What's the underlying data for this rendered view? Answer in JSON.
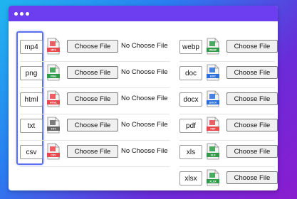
{
  "window": {
    "dots": 3
  },
  "choose_label": "Choose File",
  "status_text": "No Choose File",
  "left": [
    {
      "format": "mp4",
      "badge": "MP4",
      "color": "#e8474b"
    },
    {
      "format": "png",
      "badge": "PNG",
      "color": "#2f9a47"
    },
    {
      "format": "html",
      "badge": "HTML",
      "color": "#e8474b"
    },
    {
      "format": "txt",
      "badge": "TXT",
      "color": "#666666"
    },
    {
      "format": "csv",
      "badge": "CSV",
      "color": "#e8474b"
    }
  ],
  "right": [
    {
      "format": "webp",
      "badge": "WEBP",
      "color": "#2f9a47"
    },
    {
      "format": "doc",
      "badge": "DOC",
      "color": "#2b6fd8"
    },
    {
      "format": "docx",
      "badge": "DOCX",
      "color": "#2b6fd8"
    },
    {
      "format": "pdf",
      "badge": "PDF",
      "color": "#e8474b"
    },
    {
      "format": "xls",
      "badge": "XLS",
      "color": "#2f9a47"
    },
    {
      "format": "xlsx",
      "badge": "XLSX",
      "color": "#2f9a47"
    }
  ]
}
